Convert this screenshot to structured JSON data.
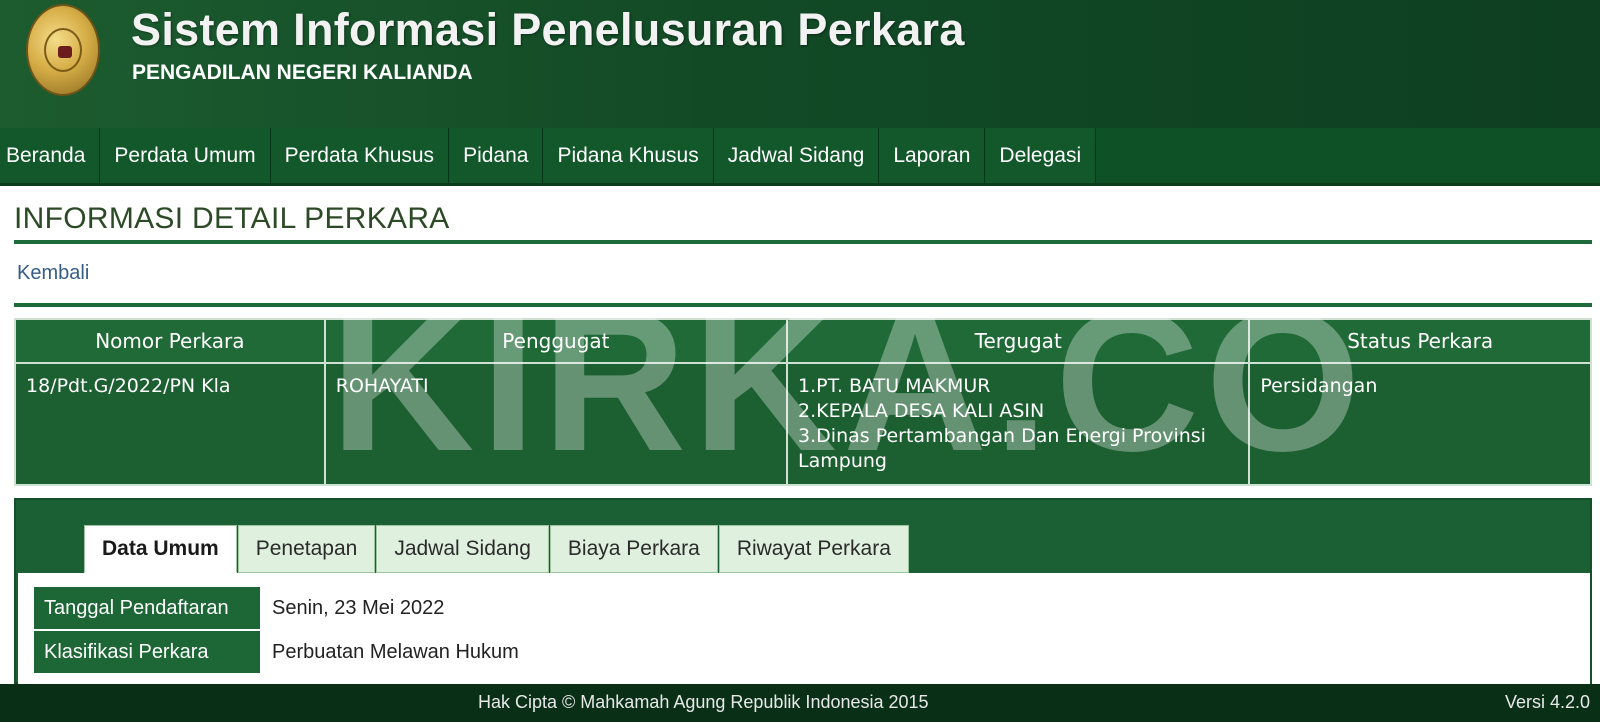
{
  "header": {
    "title": "Sistem Informasi Penelusuran Perkara",
    "subtitle": "PENGADILAN NEGERI KALIANDA"
  },
  "nav": {
    "items": [
      "Beranda",
      "Perdata Umum",
      "Perdata Khusus",
      "Pidana",
      "Pidana Khusus",
      "Jadwal Sidang",
      "Laporan",
      "Delegasi"
    ]
  },
  "page": {
    "title": "INFORMASI DETAIL PERKARA",
    "back_label": "Kembali"
  },
  "case_table": {
    "headers": [
      "Nomor Perkara",
      "Penggugat",
      "Tergugat",
      "Status Perkara"
    ],
    "row": {
      "nomor": "18/Pdt.G/2022/PN Kla",
      "penggugat": "ROHAYATI",
      "tergugat": [
        "1.PT. BATU MAKMUR",
        "2.KEPALA DESA KALI ASIN",
        "3.Dinas Pertambangan Dan Energi Provinsi Lampung"
      ],
      "status": "Persidangan"
    }
  },
  "watermark": "KIRKA.CO",
  "tabs": [
    "Data Umum",
    "Penetapan",
    "Jadwal Sidang",
    "Biaya Perkara",
    "Riwayat Perkara"
  ],
  "active_tab": "Data Umum",
  "data_umum": [
    {
      "label": "Tanggal Pendaftaran",
      "value": "Senin, 23 Mei 2022"
    },
    {
      "label": "Klasifikasi Perkara",
      "value": "Perbuatan Melawan Hukum"
    }
  ],
  "footer": {
    "copyright": "Hak Cipta © Mahkamah Agung Republik Indonesia 2015",
    "version": "Versi 4.2.0"
  },
  "colors": {
    "primary_green": "#1b6035",
    "header_green": "#124a26",
    "footer_dark": "#0a2f17",
    "link_blue": "#355d8a"
  }
}
